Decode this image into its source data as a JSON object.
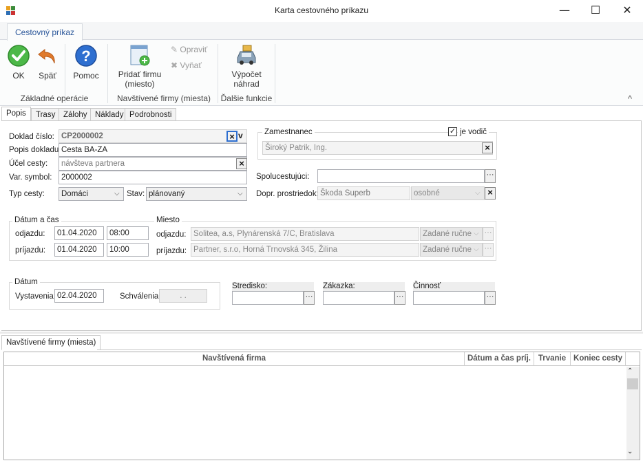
{
  "window": {
    "title": "Karta cestovného príkazu",
    "minimize": "—",
    "maximize": "☐",
    "close": "✕"
  },
  "ribbon": {
    "tab": "Cestovný príkaz",
    "ok": "OK",
    "back": "Späť",
    "help": "Pomoc",
    "add_firm_l1": "Pridať firmu",
    "add_firm_l2": "(miesto)",
    "edit": "Opraviť",
    "remove": "Vyňať",
    "calc_l1": "Výpočet",
    "calc_l2": "náhrad",
    "group_basic": "Základné operácie",
    "group_firms": "Navštívené firmy (miesta)",
    "group_more": "Ďalšie funkcie",
    "collapse": "^"
  },
  "tabs": [
    "Popis",
    "Trasy",
    "Zálohy",
    "Náklady",
    "Podrobnosti"
  ],
  "form": {
    "doc_no_label": "Doklad číslo:",
    "doc_no": "CP2000002",
    "desc_label": "Popis dokladu:",
    "desc": "Cesta BA-ZA",
    "purpose_label": "Účel cesty:",
    "purpose": "návšteva partnera",
    "varsym_label": "Var. symbol:",
    "varsym": "2000002",
    "type_label": "Typ cesty:",
    "type": "Domáci",
    "state_label": "Stav:",
    "state": "plánovaný",
    "employee_group": "Zamestnanec",
    "driver_label": "je vodič",
    "employee": "Široký Patrik, Ing.",
    "copassengers_label": "Spolucestujúci:",
    "copassengers": "",
    "transport_label": "Dopr. prostriedok:",
    "transport": "Škoda Superb",
    "transport_type": "osobné",
    "dt_group": "Dátum a čas",
    "depart_label": "odjazdu:",
    "arrive_label": "príjazdu:",
    "depart_date": "01.04.2020",
    "depart_time": "08:00",
    "arrive_date": "01.04.2020",
    "arrive_time": "10:00",
    "place_group": "Miesto",
    "place_depart_label": "odjazdu:",
    "place_arrive_label": "príjazdu:",
    "place_depart": "Solitea, a.s, Plynárenská 7/C, Bratislava",
    "place_arrive": "Partner, s.r.o, Horná Trnovská 345, Žilina",
    "manual": "Zadané ručne",
    "date_group": "Dátum",
    "issued_label": "Vystavenia:",
    "issued": "02.04.2020",
    "approved_label": "Schválenia:",
    "approved": ".   .",
    "center_label": "Stredisko:",
    "order_label": "Zákazka:",
    "activity_label": "Činnosť"
  },
  "bottom": {
    "tab": "Navštívené firmy (miesta)",
    "columns": [
      "Navštívená firma",
      "Dátum a čas príj.",
      "Trvanie",
      "Koniec cesty"
    ]
  }
}
